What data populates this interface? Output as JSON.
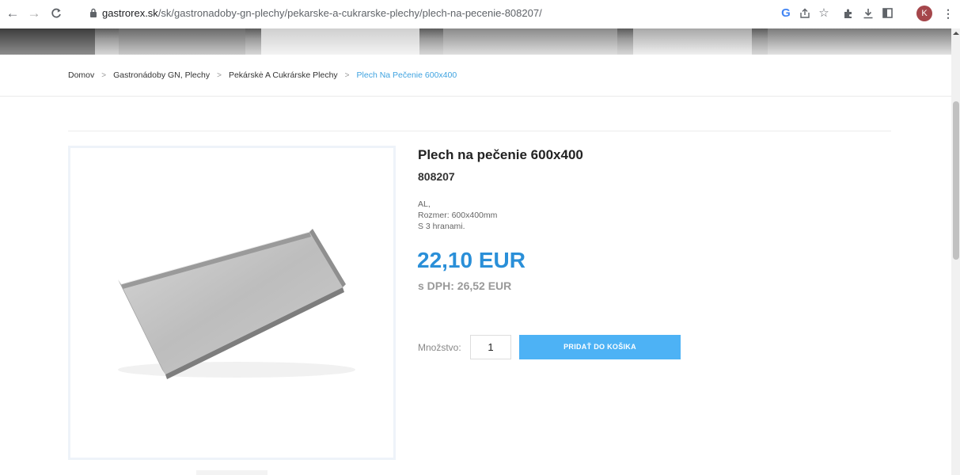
{
  "browser": {
    "url_host": "gastrorex.sk",
    "url_path": "/sk/gastronadoby-gn-plechy/pekarske-a-cukrarske-plechy/plech-na-pecenie-808207/",
    "avatar_letter": "K",
    "icons": [
      "back-icon",
      "forward-icon",
      "reload-icon",
      "lock-icon",
      "google-icon",
      "share-icon",
      "star-icon",
      "extensions-icon",
      "download-icon",
      "sidepanel-icon",
      "menu-icon"
    ]
  },
  "breadcrumb": {
    "items": [
      "Domov",
      "Gastronádoby GN, Plechy",
      "Pekárskė A Cukrárske Plechy"
    ],
    "current": "Plech Na Pečenie 600x400",
    "separator": ">"
  },
  "product": {
    "title": "Plech na pečenie 600x400",
    "code": "808207",
    "description_lines": [
      "AL,",
      "Rozmer: 600x400mm",
      "S 3 hranami."
    ],
    "price": "22,10 EUR",
    "price_vat": "s DPH: 26,52 EUR",
    "quantity_label": "Množstvo:",
    "quantity_value": "1",
    "add_to_cart_label": "PRIDAŤ DO KOŠIKA"
  },
  "colors": {
    "accent": "#2a8fd8",
    "button": "#4db2f5",
    "breadcrumb_current": "#3fa3e0"
  }
}
